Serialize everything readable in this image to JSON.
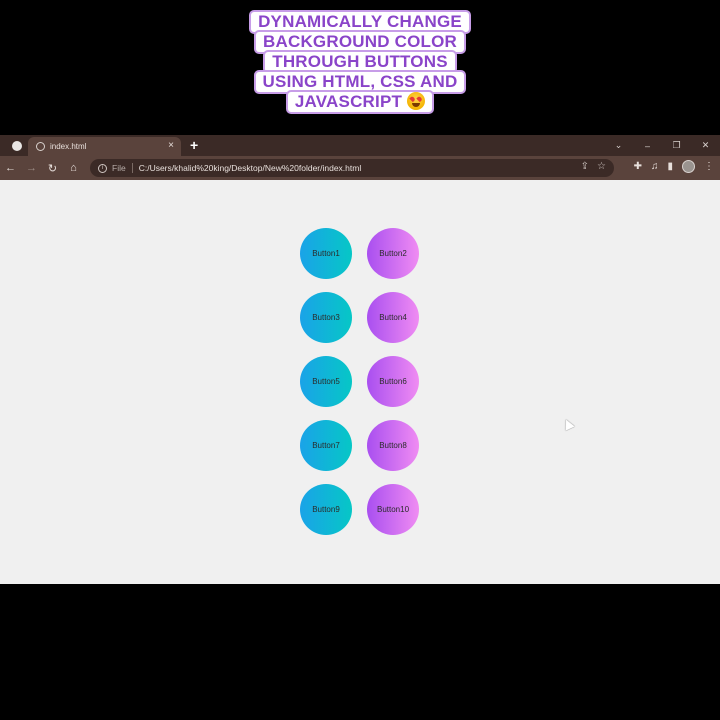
{
  "caption": {
    "lines": [
      "DYNAMICALLY CHANGE",
      "BACKGROUND COLOR",
      "THROUGH BUTTONS",
      "USING HTML, CSS AND",
      "JAVASCRIPT"
    ],
    "emoji": "star-struck-emoji"
  },
  "browser": {
    "tab_title": "index.html",
    "tab_close": "×",
    "new_tab": "+",
    "window_controls": [
      "⌄",
      "–",
      "❐",
      "✕"
    ],
    "nav": {
      "back": "←",
      "forward": "→",
      "reload": "↻",
      "home": "⌂"
    },
    "address": {
      "scheme_label": "File",
      "url": "C:/Users/khalid%20king/Desktop/New%20folder/index.html"
    },
    "toolbar_icons": [
      "share-icon",
      "star-icon",
      "extensions-icon",
      "media-icon",
      "sidebar-icon",
      "profile-avatar",
      "menu-icon"
    ]
  },
  "page": {
    "buttons": [
      {
        "label": "Button1",
        "style": "left"
      },
      {
        "label": "Button2",
        "style": "right"
      },
      {
        "label": "Button3",
        "style": "left"
      },
      {
        "label": "Button4",
        "style": "right"
      },
      {
        "label": "Button5",
        "style": "left"
      },
      {
        "label": "Button6",
        "style": "right"
      },
      {
        "label": "Button7",
        "style": "left"
      },
      {
        "label": "Button8",
        "style": "right"
      },
      {
        "label": "Button9",
        "style": "left"
      },
      {
        "label": "Button10",
        "style": "right"
      }
    ],
    "colors": {
      "left_gradient": [
        "#1aa3e8",
        "#06c7c6"
      ],
      "right_gradient": [
        "#a94ff0",
        "#f08cf2"
      ],
      "page_background": "#f0f0f0"
    }
  }
}
